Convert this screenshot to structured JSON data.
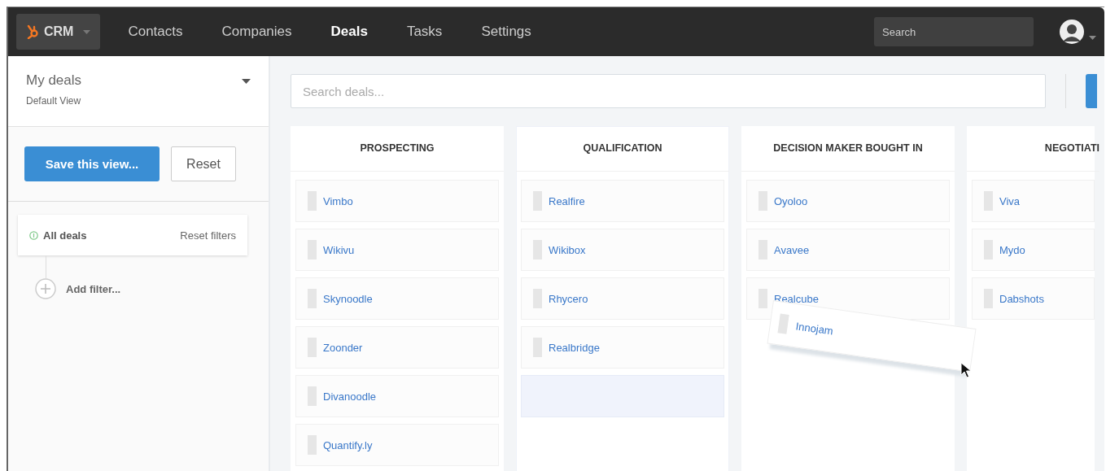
{
  "nav": {
    "app": "CRM",
    "items": [
      {
        "label": "Contacts",
        "selected": false
      },
      {
        "label": "Companies",
        "selected": false
      },
      {
        "label": "Deals",
        "selected": true
      },
      {
        "label": "Tasks",
        "selected": false
      },
      {
        "label": "Settings",
        "selected": false
      }
    ],
    "search": {
      "placeholder": "Search"
    }
  },
  "sidebar": {
    "view_title": "My deals",
    "view_subtitle": "Default View",
    "save_button": "Save this view...",
    "reset_button": "Reset",
    "filter_name": "All deals",
    "reset_filters": "Reset filters",
    "add_filter": "Add filter..."
  },
  "board": {
    "search": {
      "placeholder": "Search deals..."
    },
    "columns": [
      {
        "title": "PROSPECTING",
        "cut": false,
        "drop_target": false,
        "deals": [
          "Vimbo",
          "Wikivu",
          "Skynoodle",
          "Zoonder",
          "Divanoodle",
          "Quantify.ly"
        ]
      },
      {
        "title": "QUALIFICATION",
        "cut": false,
        "drop_target": true,
        "deals": [
          "Realfire",
          "Wikibox",
          "Rhycero",
          "Realbridge"
        ]
      },
      {
        "title": "DECISION MAKER BOUGHT IN",
        "cut": false,
        "drop_target": false,
        "deals": [
          "Oyoloo",
          "Avavee",
          "Realcube"
        ]
      },
      {
        "title": "NEGOTIATI",
        "cut": true,
        "drop_target": false,
        "deals": [
          "Viva",
          "Mydo",
          "Dabshots"
        ]
      }
    ],
    "dragged_deal": "Innojam"
  }
}
